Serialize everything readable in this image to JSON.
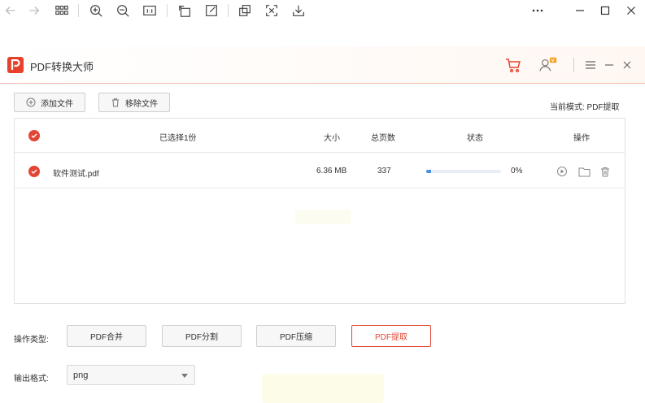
{
  "viewer_toolbar": {
    "icons": [
      "back-arrow-icon",
      "forward-arrow-icon",
      "grid-icon",
      "zoom-in-icon",
      "zoom-out-icon",
      "actual-size-icon",
      "rotate-icon",
      "edit-icon",
      "copy-icon",
      "fullscreen-icon",
      "download-icon"
    ],
    "window": [
      "more-icon",
      "minimize-icon",
      "maximize-icon",
      "close-icon"
    ]
  },
  "app": {
    "title": "PDF转换大师",
    "brand_color": "#e8402b"
  },
  "actions": {
    "add_label": "添加文件",
    "remove_label": "移除文件",
    "mode_label": "当前模式: PDF提取"
  },
  "table": {
    "headers": {
      "selected": "已选择1份",
      "size": "大小",
      "pages": "总页数",
      "status": "状态",
      "operations": "操作"
    },
    "rows": [
      {
        "name": "软件测试.pdf",
        "size": "6.36 MB",
        "pages": "337",
        "progress_text": "0%",
        "progress": 0.07
      }
    ]
  },
  "operation": {
    "label": "操作类型:",
    "buttons": [
      "PDF合并",
      "PDF分割",
      "PDF压缩",
      "PDF提取"
    ],
    "active_index": 3,
    "accent_color": "#e24534"
  },
  "output": {
    "label": "输出格式:",
    "selected": "png"
  }
}
